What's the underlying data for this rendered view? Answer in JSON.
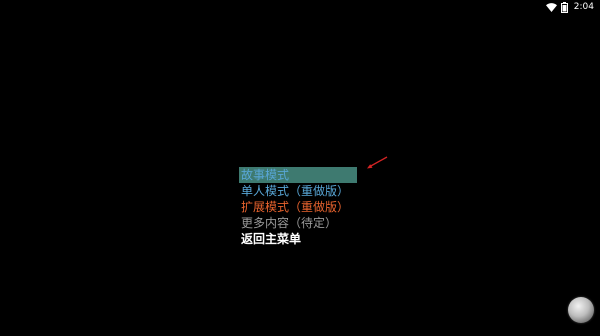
{
  "status_bar": {
    "time": "2:04",
    "icons": [
      "wifi-icon",
      "battery-icon"
    ]
  },
  "menu": {
    "items": [
      {
        "label": "故事模式",
        "color": "#58a6d6",
        "selected": true
      },
      {
        "label": "单人模式（重做版）",
        "color": "#58a6d6",
        "selected": false
      },
      {
        "label": "扩展模式（重做版）",
        "color": "#e8632e",
        "selected": false
      },
      {
        "label": "更多内容（待定）",
        "color": "#9a9a9a",
        "selected": false
      },
      {
        "label": "返回主菜单",
        "color": "#ffffff",
        "selected": false
      }
    ],
    "selection_color": "#3e7a70"
  },
  "annotation": {
    "arrow_color": "#d42424",
    "icon": "red-arrow-icon"
  },
  "floating_button": {
    "icon": "assistive-touch-icon"
  }
}
